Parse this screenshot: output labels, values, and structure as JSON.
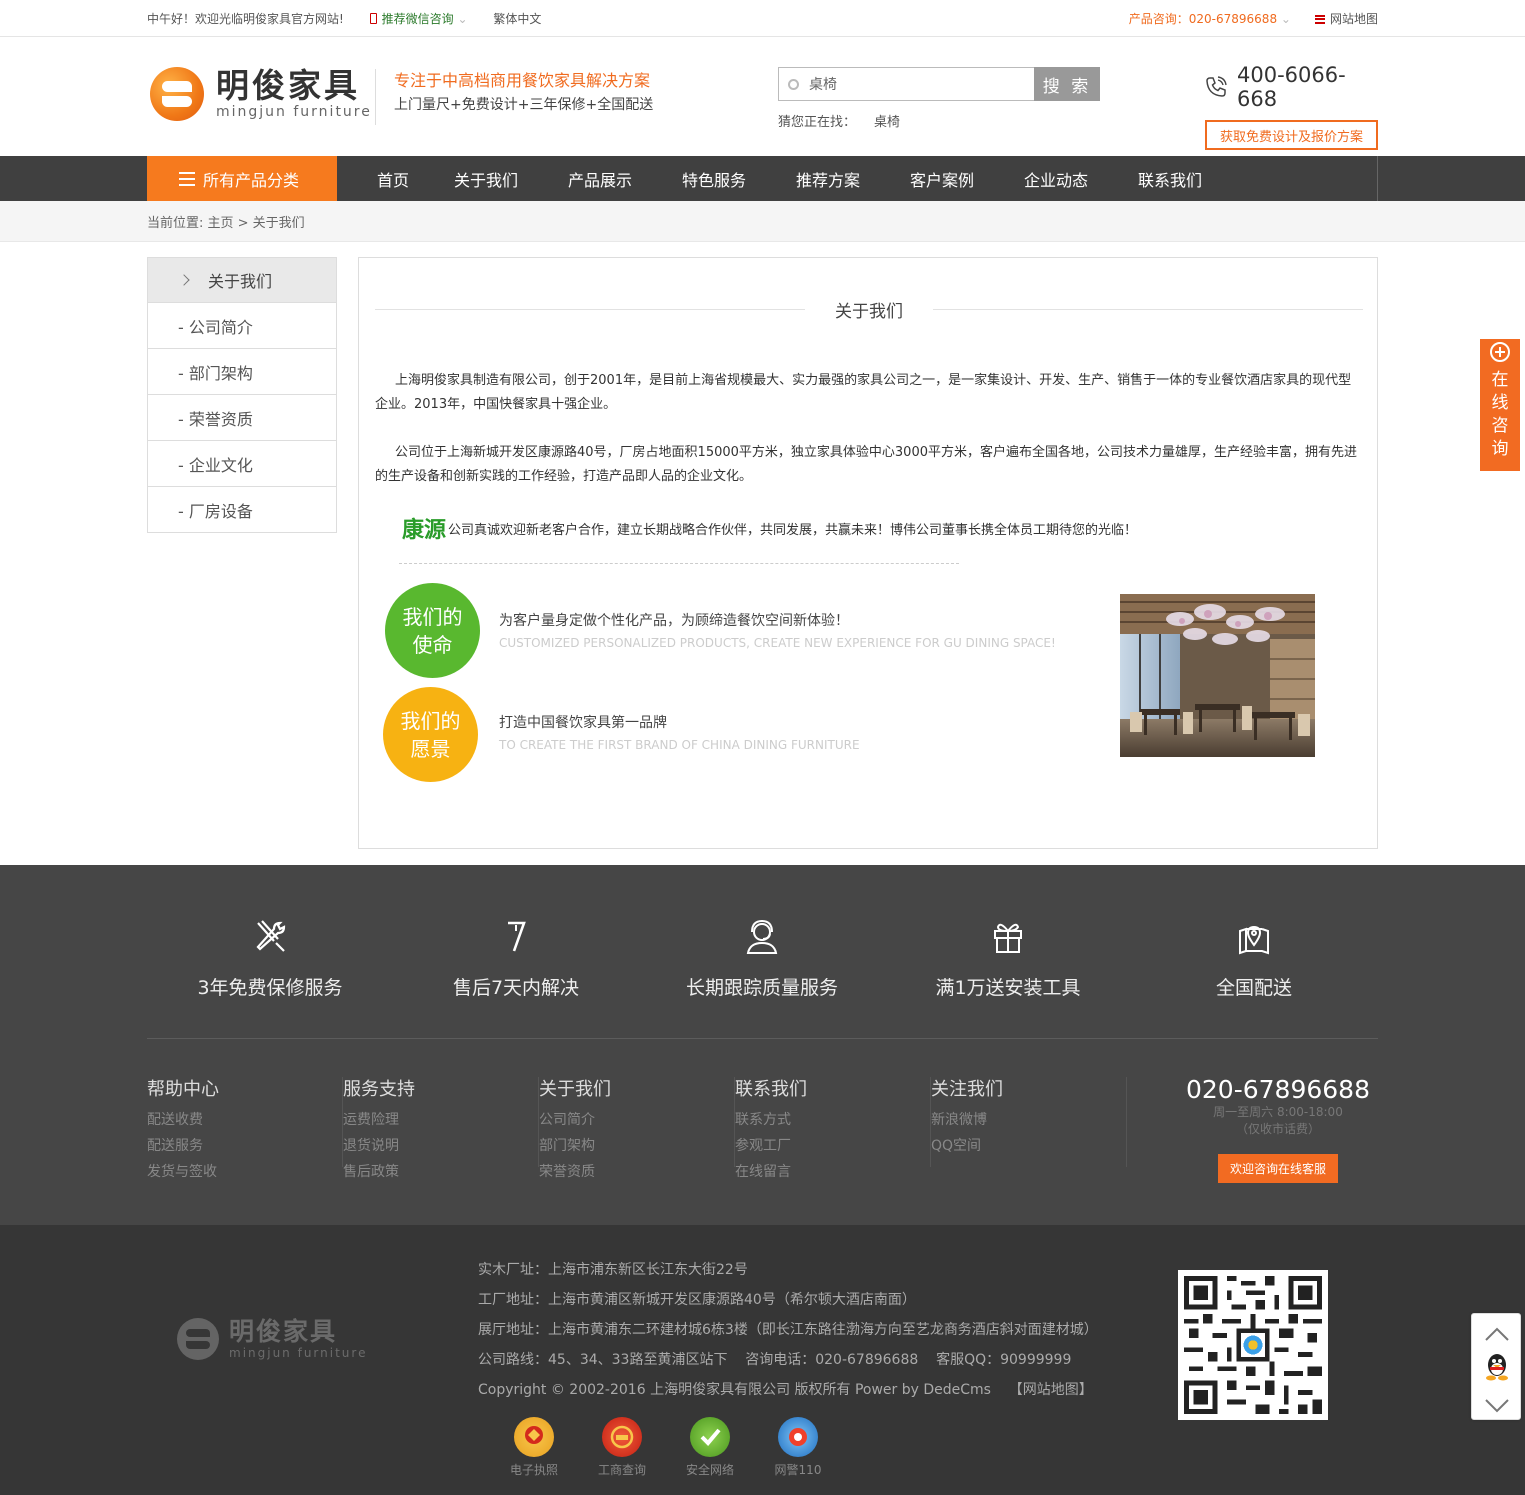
{
  "topbar": {
    "greeting": "中午好！欢迎光临明俊家具官方网站!",
    "wechat": "推荐微信咨询",
    "traditional": "繁体中文",
    "phone": "产品咨询：020-67896688",
    "sitemap": "网站地图"
  },
  "header": {
    "logo_cn": "明俊家具",
    "logo_en": "mingjun furniture",
    "slogan_main": "专注于中高档商用餐饮家具解决方案",
    "slogan_sub": "上门量尺+免费设计+三年保修+全国配送",
    "search_value": "桌椅",
    "search_button": "搜 索",
    "hot_label": "猜您正在找：",
    "hot_word": "桌椅",
    "hotline": "400-6066-668",
    "quote_button": "获取免费设计及报价方案"
  },
  "nav": {
    "all_categories": "所有产品分类",
    "items": [
      "首页",
      "关于我们",
      "产品展示",
      "特色服务",
      "推荐方案",
      "客户案例",
      "企业动态",
      "联系我们"
    ]
  },
  "breadcrumb": "当前位置: 主页 > 关于我们",
  "sidebar": {
    "title": "关于我们",
    "items": [
      "- 公司简介",
      "- 部门架构",
      "- 荣誉资质",
      "- 企业文化",
      "- 厂房设备"
    ]
  },
  "content": {
    "title": "关于我们",
    "para1": "上海明俊家具制造有限公司，创于2001年，是目前上海省规模最大、实力最强的家具公司之一，是一家集设计、开发、生产、销售于一体的专业餐饮酒店家具的现代型企业。2013年，中国快餐家具十强企业。",
    "para2": "公司位于上海新城开发区康源路40号，厂房占地面积15000平方米，独立家具体验中心3000平方米，客户遍布全国各地，公司技术力量雄厚，生产经验丰富，拥有先进的生产设备和创新实践的工作经验，打造产品即人品的企业文化。",
    "brand": "康源",
    "para3": "公司真诚欢迎新老客户合作，建立长期战略合作伙伴，共同发展，共赢未来！博伟公司董事长携全体员工期待您的光临！",
    "mission_circle_1": "我们的",
    "mission_circle_2": "使命",
    "mission_cn": "为客户量身定做个性化产品，为顾缔造餐饮空间新体验！",
    "mission_en": "CUSTOMIZED PERSONALIZED PRODUCTS, CREATE NEW EXPERIENCE FOR GU DINING SPACE!",
    "vision_circle_1": "我们的",
    "vision_circle_2": "愿景",
    "vision_cn": "打造中国餐饮家具第一品牌",
    "vision_en": "TO CREATE THE FIRST BRAND OF CHINA DINING FURNITURE",
    "mission_color": "#59b82f",
    "vision_color": "#f7b212"
  },
  "float_consult": [
    "在",
    "线",
    "咨",
    "询"
  ],
  "services": [
    {
      "icon": "tools-icon",
      "label": "3年免费保修服务"
    },
    {
      "icon": "seven-icon",
      "label": "售后7天内解决"
    },
    {
      "icon": "support-person-icon",
      "label": "长期跟踪质量服务"
    },
    {
      "icon": "gift-icon",
      "label": "满1万送安装工具"
    },
    {
      "icon": "map-pin-icon",
      "label": "全国配送"
    }
  ],
  "footer_links": [
    {
      "title": "帮助中心",
      "items": [
        "配送收费",
        "配送服务",
        "发货与签收"
      ]
    },
    {
      "title": "服务支持",
      "items": [
        "运费险理",
        "退货说明",
        "售后政策"
      ]
    },
    {
      "title": "关于我们",
      "items": [
        "公司简介",
        "部门架构",
        "荣誉资质"
      ]
    },
    {
      "title": "联系我们",
      "items": [
        "联系方式",
        "参观工厂",
        "在线留言"
      ]
    },
    {
      "title": "关注我们",
      "items": [
        "新浪微博",
        "QQ空间"
      ]
    }
  ],
  "contact": {
    "phone": "020-67896688",
    "hours": "周一至周六 8:00-18:00",
    "note": "（仅收市话费）",
    "button": "欢迎咨询在线客服"
  },
  "footer": {
    "logo_cn": "明俊家具",
    "logo_en": "mingjun furniture",
    "lines": [
      "实木厂址：上海市浦东新区长江东大街22号",
      "工厂地址：上海市黄浦区新城开发区康源路40号（希尔顿大酒店南面）",
      "展厅地址：上海市黄浦东二环建材城6栋3楼（即长江东路往渤海方向至艺龙商务酒店斜对面建材城）",
      "公司路线：45、34、33路至黄浦区站下    咨询电话：020-67896688    客服QQ：90999999",
      "Copyright © 2002-2016 上海明俊家具有限公司 版权所有 Power by DedeCms    【网站地图】"
    ],
    "badges": [
      {
        "icon": "license-icon",
        "label": "电子执照",
        "color": "#e8a020"
      },
      {
        "icon": "inspect-icon",
        "label": "工商查询",
        "color": "#d42a1c"
      },
      {
        "icon": "shield-check-icon",
        "label": "安全网络",
        "color": "#5aa62c"
      },
      {
        "icon": "police-icon",
        "label": "网警110",
        "color": "#2a7fd4"
      }
    ]
  }
}
